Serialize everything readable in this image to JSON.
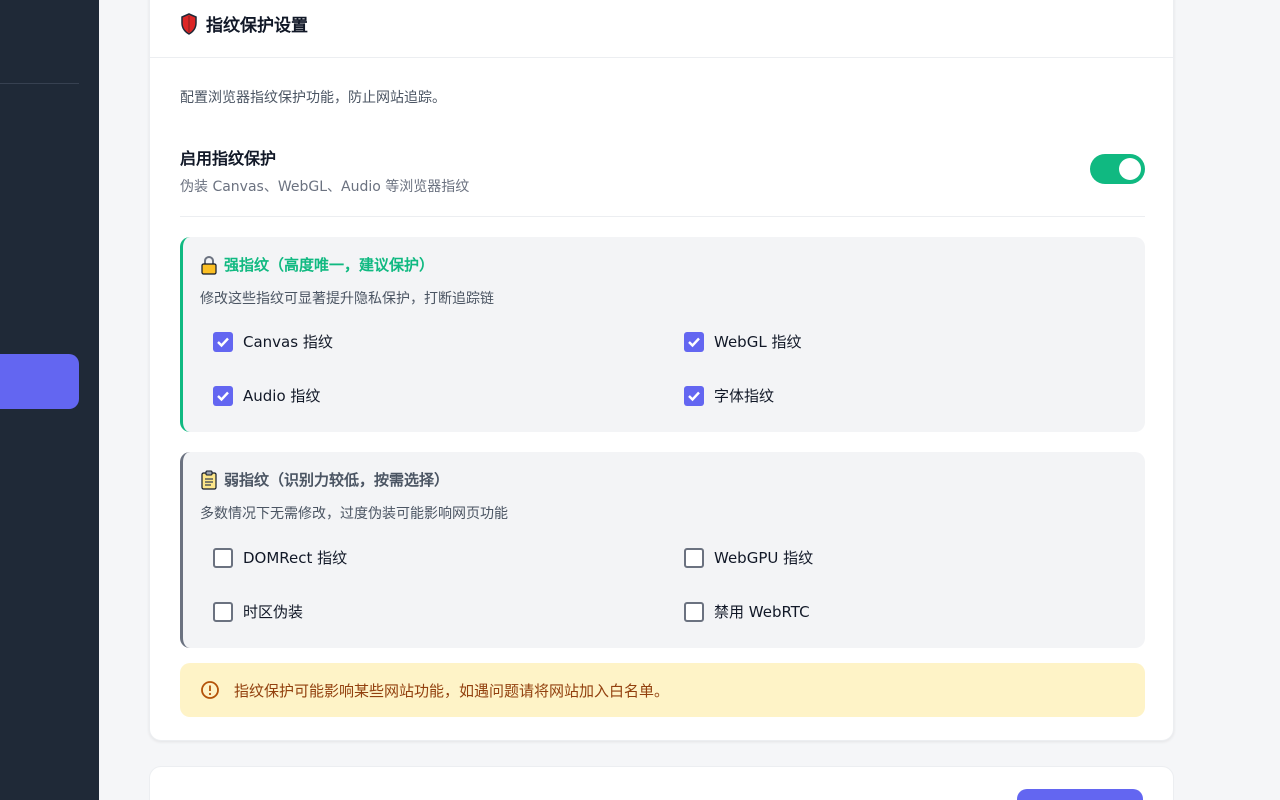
{
  "section": {
    "icon": "shield-icon",
    "title": "指纹保护设置",
    "description": "配置浏览器指纹保护功能，防止网站追踪。"
  },
  "toggle": {
    "title": "启用指纹保护",
    "subtitle": "伪装 Canvas、WebGL、Audio 等浏览器指纹",
    "enabled": true
  },
  "strong_group": {
    "icon": "lock-icon",
    "title": "强指纹（高度唯一，建议保护）",
    "description": "修改这些指纹可显著提升隐私保护，打断追踪链",
    "options": [
      {
        "label": "Canvas 指纹",
        "checked": true
      },
      {
        "label": "WebGL 指纹",
        "checked": true
      },
      {
        "label": "Audio 指纹",
        "checked": true
      },
      {
        "label": "字体指纹",
        "checked": true
      }
    ]
  },
  "weak_group": {
    "icon": "clipboard-icon",
    "title": "弱指纹（识别力较低，按需选择）",
    "description": "多数情况下无需修改，过度伪装可能影响网页功能",
    "options": [
      {
        "label": "DOMRect 指纹",
        "checked": false
      },
      {
        "label": "WebGPU 指纹",
        "checked": false
      },
      {
        "label": "时区伪装",
        "checked": false
      },
      {
        "label": "禁用 WebRTC",
        "checked": false
      }
    ]
  },
  "warning": {
    "icon": "alert-circle-icon",
    "text": "指纹保护可能影响某些网站功能，如遇问题请将网站加入白名单。"
  },
  "colors": {
    "accent": "#6366f1",
    "success": "#10b981",
    "sidebar": "#1f2937",
    "warning_bg": "#fef3c7",
    "warning_text": "#92400e"
  }
}
